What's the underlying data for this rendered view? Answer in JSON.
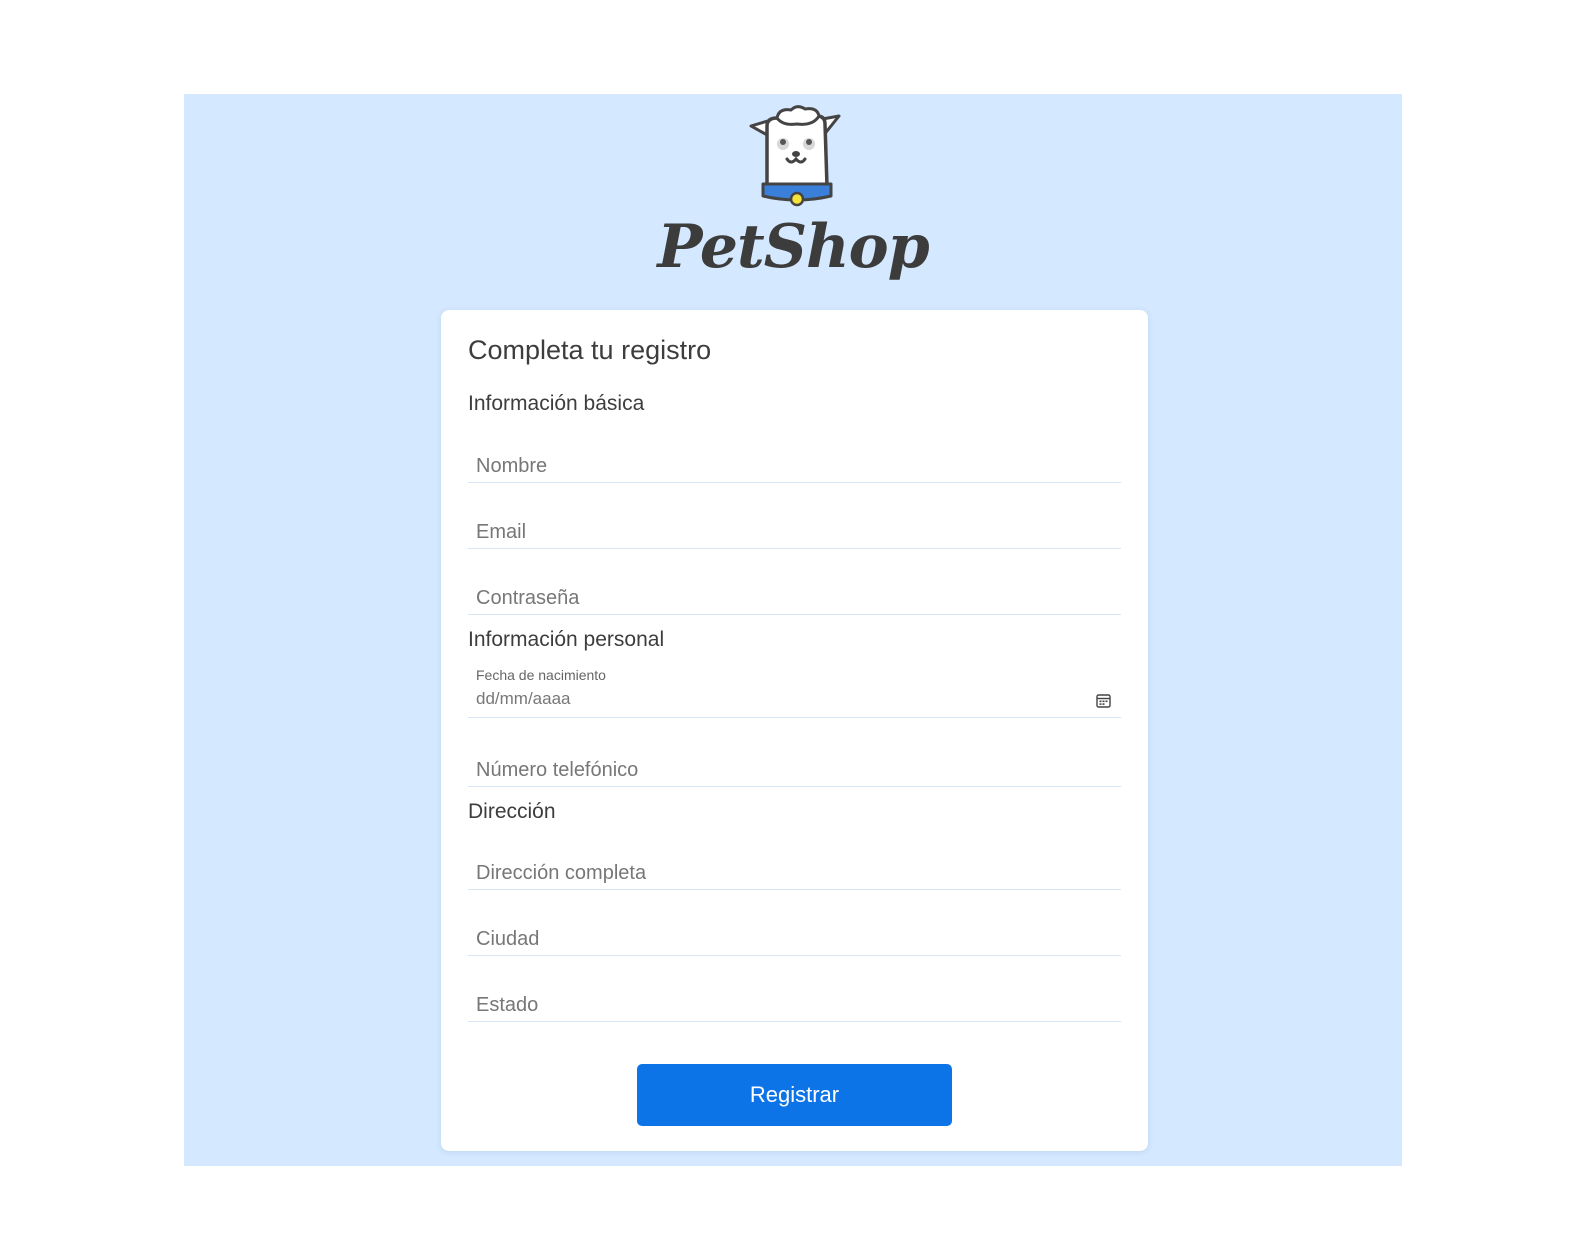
{
  "brand": {
    "name": "PetShop",
    "logo_icon": "dog-logo-icon"
  },
  "form": {
    "title": "Completa tu registro",
    "sections": {
      "basic": "Información básica",
      "personal": "Información personal",
      "address": "Dirección"
    },
    "fields": {
      "name": {
        "placeholder": "Nombre",
        "value": ""
      },
      "email": {
        "placeholder": "Email",
        "value": ""
      },
      "password": {
        "placeholder": "Contraseña",
        "value": ""
      },
      "birthdate": {
        "label": "Fecha de nacimiento",
        "placeholder": "dd/mm/aaaa",
        "icon": "calendar-icon"
      },
      "phone": {
        "placeholder": "Número telefónico",
        "value": ""
      },
      "full_address": {
        "placeholder": "Dirección completa",
        "value": ""
      },
      "city": {
        "placeholder": "Ciudad",
        "value": ""
      },
      "state": {
        "placeholder": "Estado",
        "value": ""
      }
    },
    "submit_label": "Registrar"
  },
  "colors": {
    "background": "#d4e8ff",
    "card": "#ffffff",
    "accent": "#0d74e8",
    "text": "#3d3d3d",
    "collar": "#3a7fd9",
    "tag": "#f5e23a"
  }
}
